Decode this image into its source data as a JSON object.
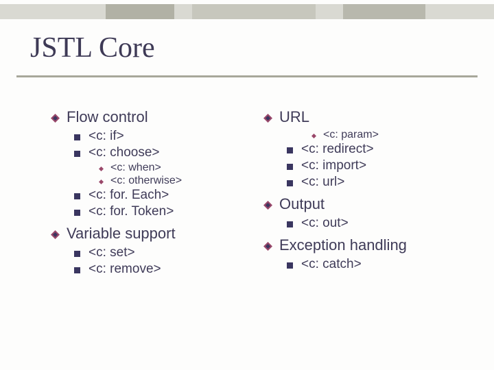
{
  "title": "JSTL Core",
  "left": {
    "section1": {
      "heading": "Flow control",
      "items": {
        "a": "<c: if>",
        "b": "<c: choose>",
        "b_children": {
          "a": "<c: when>",
          "b": "<c: otherwise>"
        },
        "c": "<c: for. Each>",
        "d": "<c: for. Token>"
      }
    },
    "section2": {
      "heading": "Variable support",
      "items": {
        "a": "<c: set>",
        "b": "<c: remove>"
      }
    }
  },
  "right": {
    "section1": {
      "heading": "URL",
      "top_children": {
        "a": "<c: param>"
      },
      "items": {
        "a": "<c: redirect>",
        "b": "<c: import>",
        "c": "<c: url>"
      }
    },
    "section2": {
      "heading": "Output",
      "items": {
        "a": "<c: out>"
      }
    },
    "section3": {
      "heading": "Exception handling",
      "items": {
        "a": "<c: catch>"
      }
    }
  },
  "colors": {
    "accent": "#9a486a",
    "text": "#3f3b58",
    "bullet_square": "#3a3660"
  }
}
